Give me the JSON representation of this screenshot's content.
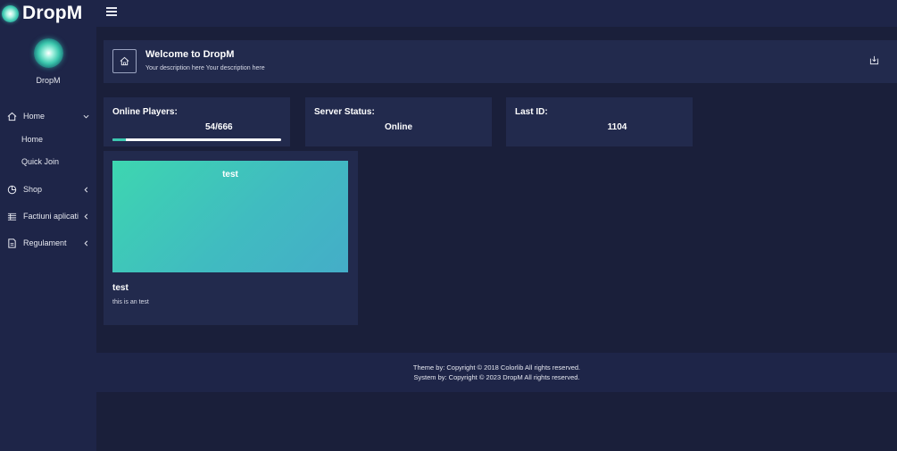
{
  "brand": {
    "name": "DropM"
  },
  "sidebar": {
    "profile_name": "DropM",
    "items": [
      {
        "label": "Home",
        "icon": "home-icon",
        "expanded": true,
        "subitems": [
          {
            "label": "Home"
          },
          {
            "label": "Quick Join"
          }
        ]
      },
      {
        "label": "Shop",
        "icon": "pie-chart-icon",
        "expanded": false
      },
      {
        "label": "Factiuni aplicati",
        "icon": "list-icon",
        "expanded": false
      },
      {
        "label": "Regulament",
        "icon": "document-icon",
        "expanded": false
      }
    ]
  },
  "header": {
    "title": "Welcome to DropM",
    "description": "Your description here Your description here"
  },
  "stats": {
    "players": {
      "label": "Online Players:",
      "value": "54/666",
      "progress": 0.08
    },
    "server": {
      "label": "Server Status:",
      "value": "Online"
    },
    "last_id": {
      "label": "Last ID:",
      "value": "1104"
    }
  },
  "card": {
    "image_caption": "test",
    "title": "test",
    "text": "this is an test"
  },
  "footer": {
    "line1": "Theme by: Copyright © 2018 Colorlib All rights reserved.",
    "line2": "System by: Copyright © 2023 DropM All rights reserved."
  },
  "colors": {
    "background": "#1a1f3a",
    "panel": "#222a4d",
    "sidebar": "#1e2548",
    "accent": "#3cc8b0"
  }
}
